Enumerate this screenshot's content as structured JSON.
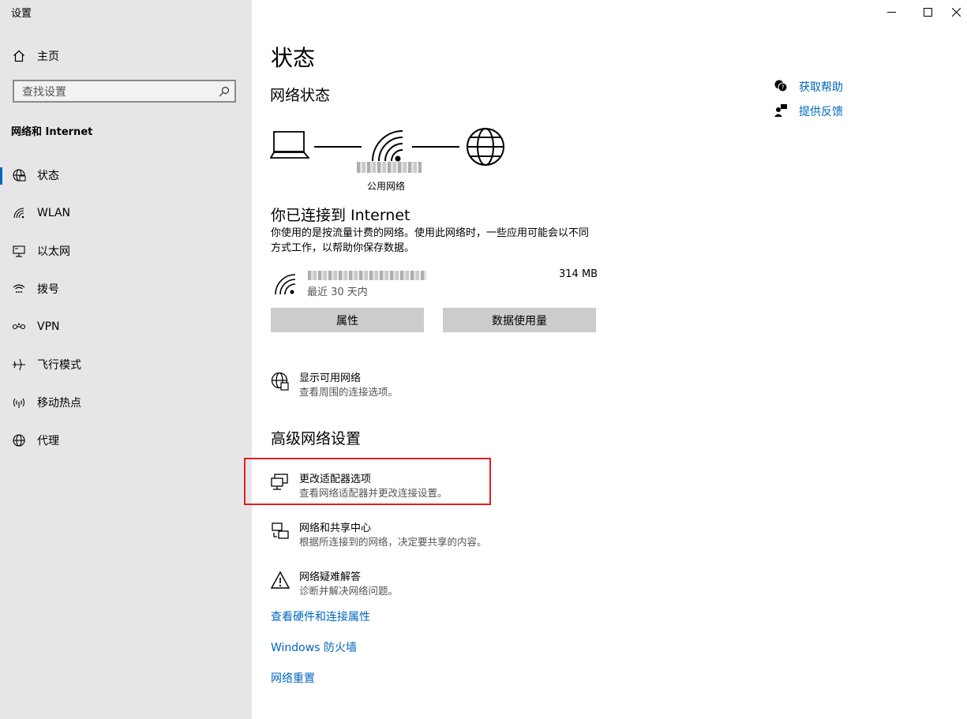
{
  "window": {
    "title": "设置"
  },
  "sidebar": {
    "home_label": "主页",
    "search_placeholder": "查找设置",
    "section_title": "网络和 Internet",
    "items": [
      {
        "label": "状态",
        "icon": "globe-status-icon",
        "active": true
      },
      {
        "label": "WLAN",
        "icon": "wifi-icon"
      },
      {
        "label": "以太网",
        "icon": "ethernet-icon"
      },
      {
        "label": "拨号",
        "icon": "dialup-icon"
      },
      {
        "label": "VPN",
        "icon": "vpn-icon"
      },
      {
        "label": "飞行模式",
        "icon": "airplane-icon"
      },
      {
        "label": "移动热点",
        "icon": "hotspot-icon"
      },
      {
        "label": "代理",
        "icon": "proxy-globe-icon"
      }
    ]
  },
  "main": {
    "page_title": "状态",
    "network_status_heading": "网络状态",
    "network_type_label": "公用网络",
    "connected_heading": "你已连接到 Internet",
    "connected_desc": "你使用的是按流量计费的网络。使用此网络时，一些应用可能会以不同方式工作，以帮助你保存数据。",
    "usage": {
      "period": "最近 30 天内",
      "amount": "314 MB"
    },
    "buttons": {
      "properties": "属性",
      "data_usage": "数据使用量"
    },
    "show_networks": {
      "title": "显示可用网络",
      "subtitle": "查看周围的连接选项。"
    },
    "advanced_heading": "高级网络设置",
    "advanced": [
      {
        "title": "更改适配器选项",
        "subtitle": "查看网络适配器并更改连接设置。"
      },
      {
        "title": "网络和共享中心",
        "subtitle": "根据所连接到的网络，决定要共享的内容。"
      },
      {
        "title": "网络疑难解答",
        "subtitle": "诊断并解决网络问题。"
      }
    ],
    "links": [
      "查看硬件和连接属性",
      "Windows 防火墙",
      "网络重置"
    ]
  },
  "help": {
    "get_help": "获取帮助",
    "feedback": "提供反馈"
  },
  "colors": {
    "accent": "#0067c0",
    "sidebar_bg": "#e6e6e6",
    "highlight": "#e02020"
  }
}
